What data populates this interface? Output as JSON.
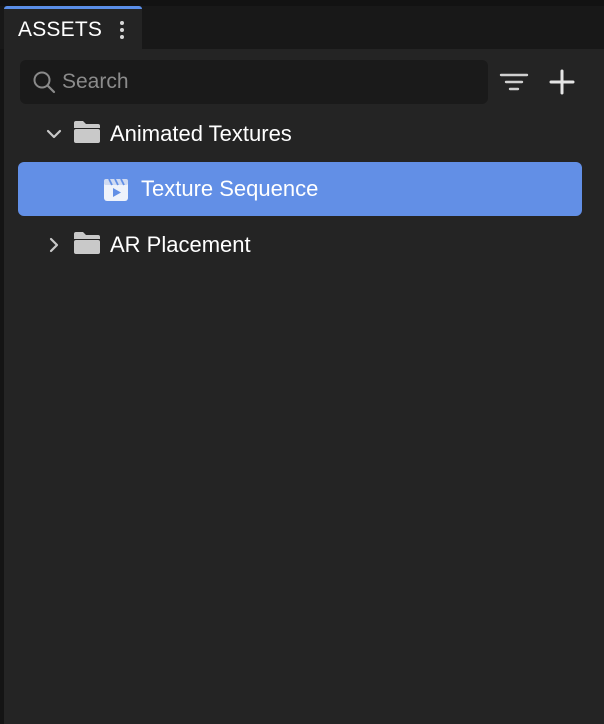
{
  "panel": {
    "tab_label": "ASSETS",
    "tab_menu_icon": "more-vertical-icon",
    "accent_color": "#5a8ee8",
    "selection_color": "#628fe6"
  },
  "search": {
    "placeholder": "Search",
    "value": ""
  },
  "toolbar": {
    "filter_icon": "filter-icon",
    "add_icon": "plus-icon"
  },
  "tree": {
    "items": [
      {
        "label": "Animated Textures",
        "type": "folder",
        "expanded": true,
        "icon": "folder-icon",
        "toggle_icon": "chevron-down-icon"
      },
      {
        "label": "Texture Sequence",
        "type": "texture-sequence",
        "selected": true,
        "icon": "texture-sequence-icon"
      },
      {
        "label": "AR Placement",
        "type": "folder",
        "expanded": false,
        "icon": "folder-icon",
        "toggle_icon": "chevron-right-icon"
      }
    ]
  }
}
